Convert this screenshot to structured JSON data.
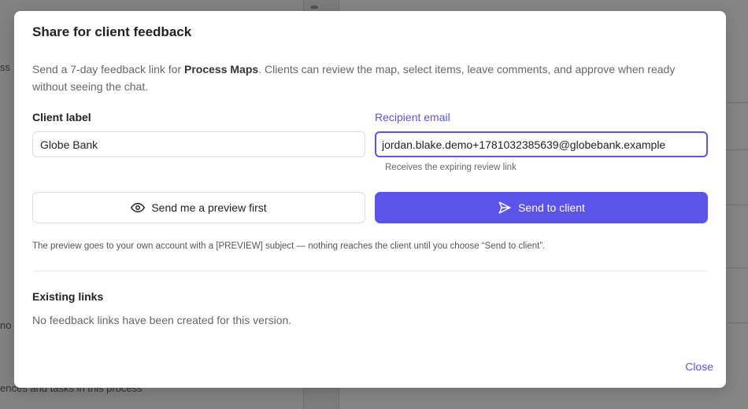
{
  "background": {
    "left_snippet_1": "ss",
    "left_snippet_2": "no",
    "bottom_snippet": "ences and tasks in this process"
  },
  "modal": {
    "title": "Share for client feedback",
    "description": {
      "prefix": "Send a 7-day feedback link for ",
      "project_name": "Process Maps",
      "suffix": ". Clients can review the map, select items, leave comments, and approve when ready without seeing the chat."
    },
    "client_label": {
      "label": "Client label",
      "value": "Globe Bank"
    },
    "recipient_email": {
      "label": "Recipient email",
      "value": "jordan.blake.demo+1781032385639@globebank.example",
      "helper": "Receives the expiring review link"
    },
    "preview_button": {
      "label": "Send me a preview first",
      "icon": "eye-icon"
    },
    "send_button": {
      "label": "Send to client",
      "icon": "send-icon"
    },
    "note": "The preview goes to your own account with a [PREVIEW] subject — nothing reaches the client until you choose “Send to client”.",
    "existing_links": {
      "title": "Existing links",
      "empty_text": "No feedback links have been created for this version."
    },
    "close_label": "Close"
  },
  "colors": {
    "accent": "#5b54e8",
    "overlay": "#7c7c7c"
  }
}
